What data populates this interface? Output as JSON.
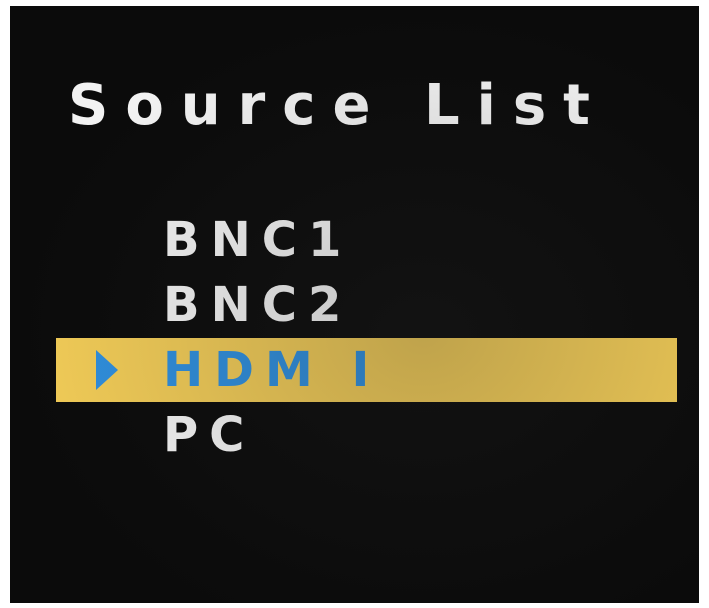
{
  "osd": {
    "title": "Source List",
    "selected_source": "HDM I",
    "sources": [
      {
        "label": "BNC1"
      },
      {
        "label": "BNC2"
      },
      {
        "label": "HDM I"
      },
      {
        "label": "PC"
      }
    ],
    "colors": {
      "background": "#0b0b0b",
      "text": "#f4f4f4",
      "highlight_bar": "#f2cc57",
      "selected_text": "#2f8fde"
    },
    "icons": {
      "selection_indicator": "triangle-right-icon"
    }
  }
}
